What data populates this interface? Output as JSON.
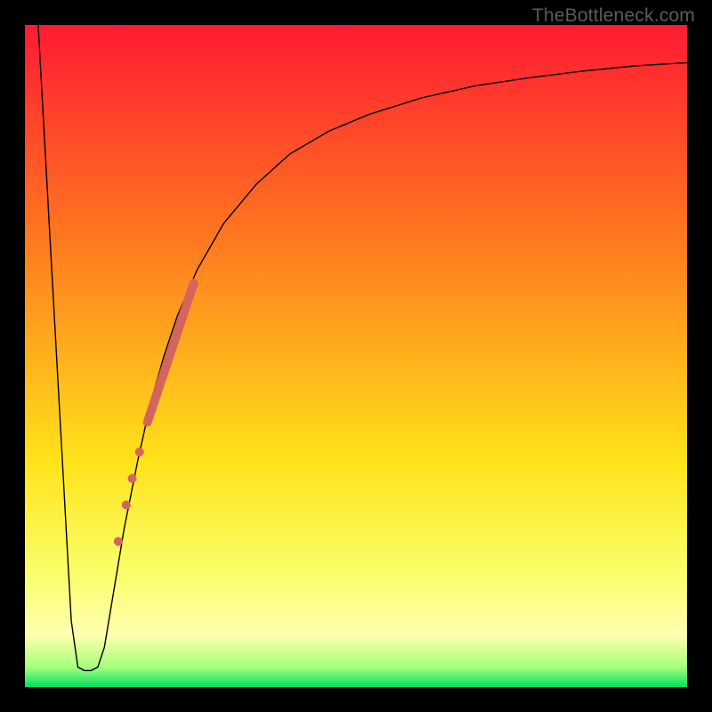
{
  "watermark": "TheBottleneck.com",
  "chart_data": {
    "type": "line",
    "title": "",
    "xlabel": "",
    "ylabel": "",
    "xlim": [
      0,
      100
    ],
    "ylim": [
      0,
      100
    ],
    "grid": false,
    "legend": false,
    "background_gradient": {
      "stops": [
        {
          "offset": 0.0,
          "color": "#ff1a33"
        },
        {
          "offset": 0.33,
          "color": "#ff7a1f"
        },
        {
          "offset": 0.66,
          "color": "#ffe31a"
        },
        {
          "offset": 0.83,
          "color": "#f9ff6b"
        },
        {
          "offset": 0.92,
          "color": "#ffffb0"
        },
        {
          "offset": 0.97,
          "color": "#a6ff7a"
        },
        {
          "offset": 1.0,
          "color": "#00e060"
        }
      ]
    },
    "series": [
      {
        "name": "curve",
        "color": "#000000",
        "stroke_width": 1.4,
        "x": [
          2,
          3,
          4,
          5,
          6,
          7,
          8,
          9,
          10,
          11,
          12,
          13,
          14,
          15,
          17,
          19,
          21,
          23,
          26,
          30,
          35,
          40,
          46,
          52,
          60,
          68,
          76,
          84,
          92,
          100
        ],
        "y": [
          100,
          82,
          64,
          46,
          28,
          10,
          3,
          2.5,
          2.5,
          3,
          6,
          12,
          18,
          24,
          34,
          43,
          50,
          56,
          63,
          70,
          76,
          80.5,
          84,
          86.5,
          89,
          90.8,
          92,
          93,
          93.8,
          94.3
        ]
      }
    ],
    "highlight_segment": {
      "name": "highlighted-range",
      "color": "#d6645c",
      "stroke_width": 10,
      "x": [
        18.5,
        25.5
      ],
      "y": [
        40,
        61
      ]
    },
    "highlight_dots": {
      "name": "highlighted-dots",
      "color": "#d6645c",
      "radius": 5,
      "points": [
        {
          "x": 17.3,
          "y": 35.5
        },
        {
          "x": 16.2,
          "y": 31.5
        },
        {
          "x": 15.3,
          "y": 27.5
        },
        {
          "x": 14.1,
          "y": 22.0
        }
      ]
    }
  }
}
